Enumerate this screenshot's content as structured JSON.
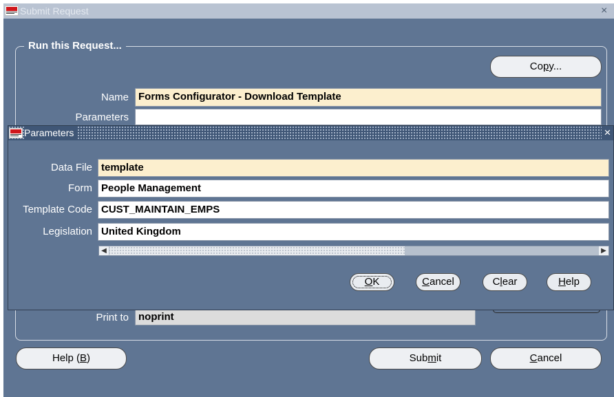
{
  "window": {
    "title": "Submit Request",
    "close": "×"
  },
  "group": {
    "label": "Run this Request..."
  },
  "copy_button": {
    "pre": "Co",
    "mnemonic": "p",
    "post": "y..."
  },
  "name": {
    "label": "Name",
    "value": "Forms Configurator - Download Template"
  },
  "parameters": {
    "label": "Parameters",
    "value": ""
  },
  "print_to": {
    "label": "Print to",
    "value": "noprint"
  },
  "bottom_buttons": {
    "help": {
      "pre": "Help (",
      "mnemonic": "B",
      "post": ")"
    },
    "submit": {
      "pre": "Sub",
      "mnemonic": "m",
      "post": "it"
    },
    "cancel": {
      "pre": "",
      "mnemonic": "C",
      "post": "ancel"
    }
  },
  "dialog": {
    "title": "Parameters",
    "close": "×",
    "fields": [
      {
        "label": "Data File",
        "value": "template",
        "required": true
      },
      {
        "label": "Form",
        "value": "People Management",
        "required": false
      },
      {
        "label": "Template Code",
        "value": "CUST_MAINTAIN_EMPS",
        "required": false
      },
      {
        "label": "Legislation",
        "value": "United Kingdom",
        "required": false
      }
    ],
    "buttons": {
      "ok": {
        "pre": "",
        "mnemonic": "O",
        "post": "K"
      },
      "cancel": {
        "pre": "",
        "mnemonic": "C",
        "post": "ancel"
      },
      "clear": {
        "pre": "C",
        "mnemonic": "l",
        "post": "ear"
      },
      "help": {
        "pre": "",
        "mnemonic": "H",
        "post": "elp"
      }
    }
  },
  "colors": {
    "window_bg": "#5f7593",
    "required_field": "#fcefce",
    "dialog_title": "#3f5676"
  }
}
